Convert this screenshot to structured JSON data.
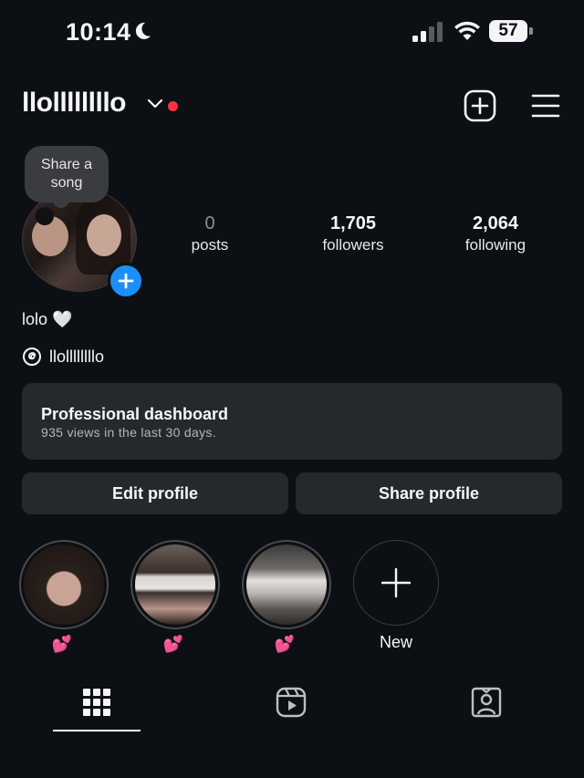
{
  "status_bar": {
    "time": "10:14",
    "battery": "57",
    "icons": [
      "moon-icon",
      "signal-icon",
      "wifi-icon",
      "battery-icon"
    ]
  },
  "header": {
    "username": "llollllllllo",
    "icons": [
      "chevron-down-icon",
      "new-post-icon",
      "menu-icon"
    ],
    "notification_dot_color": "#ff3040"
  },
  "profile": {
    "note_bubble": "Share a song",
    "stats": [
      {
        "value": "0",
        "label": "posts"
      },
      {
        "value": "1,705",
        "label": "followers"
      },
      {
        "value": "2,064",
        "label": "following"
      }
    ],
    "bio": "lolo 🤍",
    "threads_handle": "llollllllllo"
  },
  "dashboard": {
    "title": "Professional dashboard",
    "subtitle": "935 views in the last 30 days."
  },
  "buttons": {
    "edit": "Edit profile",
    "share": "Share profile"
  },
  "highlights": [
    {
      "caption": "💕"
    },
    {
      "caption": "💕"
    },
    {
      "caption": "💕"
    },
    {
      "caption": "New"
    }
  ],
  "tabs": [
    "grid-icon",
    "reels-icon",
    "tagged-icon"
  ],
  "colors": {
    "background": "#0c1014",
    "card": "#25292e",
    "accent": "#1c8ef9"
  }
}
